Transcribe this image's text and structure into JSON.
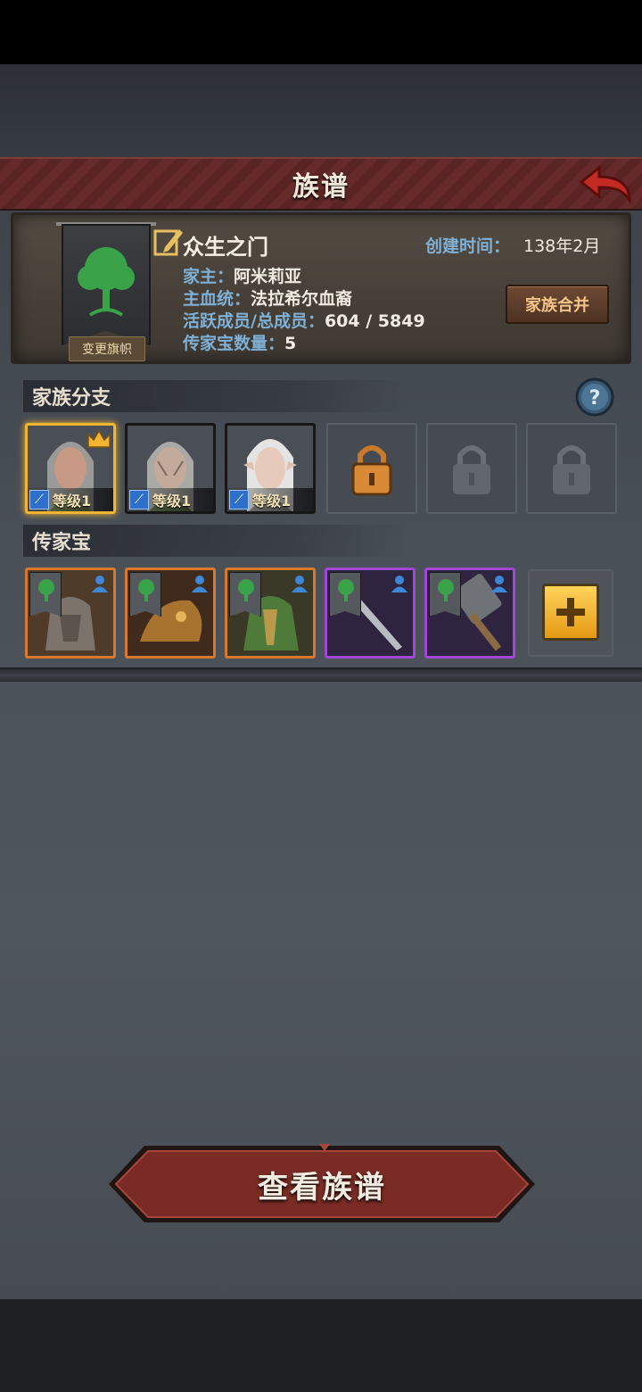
{
  "header": {
    "title": "族谱"
  },
  "family": {
    "name": "众生之门",
    "change_banner_label": "变更旗帜",
    "founded_label": "创建时间：",
    "founded_value": "138年2月",
    "leader_label": "家主：",
    "leader_value": "阿米莉亚",
    "bloodline_label": "主血统：",
    "bloodline_value": "法拉希尔血裔",
    "members_label": "活跃成员/总成员：",
    "members_value": "604 / 5849",
    "heirloom_count_label": "传家宝数量：",
    "heirloom_count_value": "5",
    "merge_button": "家族合并"
  },
  "branches": {
    "title": "家族分支",
    "members": [
      {
        "level_label": "等级1",
        "selected": true,
        "crown": true
      },
      {
        "level_label": "等级1",
        "selected": false,
        "crown": false
      },
      {
        "level_label": "等级1",
        "selected": false,
        "crown": false
      }
    ],
    "locked_slots": 3
  },
  "heirlooms": {
    "title": "传家宝",
    "items": [
      {
        "rarity": "orange",
        "art": "armor-icon"
      },
      {
        "rarity": "orange",
        "art": "dragon-helm-icon"
      },
      {
        "rarity": "orange",
        "art": "green-armor-icon"
      },
      {
        "rarity": "purple",
        "art": "sword-icon"
      },
      {
        "rarity": "purple",
        "art": "hammer-icon"
      }
    ]
  },
  "footer": {
    "view_button": "查看族谱"
  },
  "colors": {
    "title_bar": "#5a2424",
    "label_blue": "#7fb0d6",
    "gold": "#f2b431",
    "orange": "#d9792e",
    "purple": "#a246d6"
  }
}
